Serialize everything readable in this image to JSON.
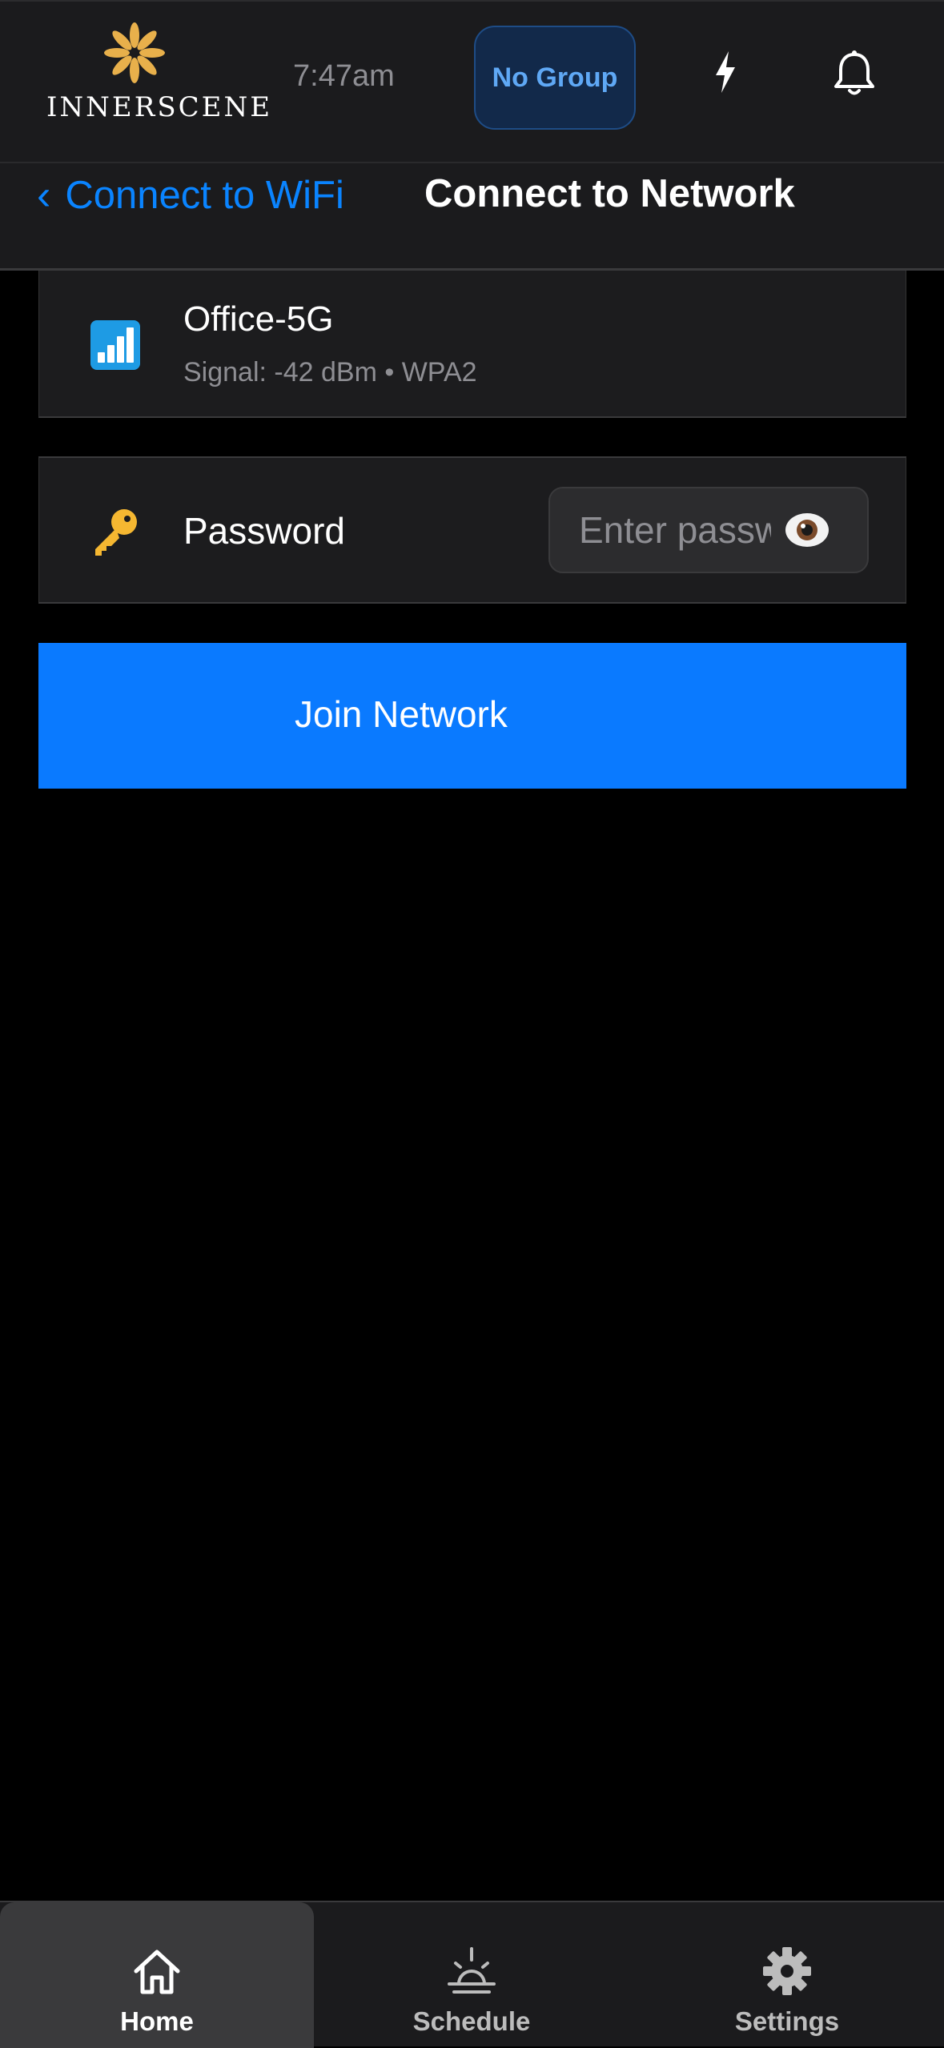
{
  "header": {
    "logo_text": "INNERSCENE",
    "time": "7:47am",
    "group_button": "No Group",
    "icons": [
      "lightning-icon",
      "bell-icon"
    ]
  },
  "nav": {
    "back_label": "Connect to WiFi",
    "back_chevron": "‹",
    "title": "Connect to Network"
  },
  "network": {
    "name": "Office-5G",
    "details": "Signal: -42 dBm • WPA2",
    "icon": "wifi-signal-icon"
  },
  "password": {
    "label": "Password",
    "placeholder": "Enter password",
    "value": "",
    "icon": "key-icon",
    "toggle_icon": "eye-icon"
  },
  "join_button": "Join Network",
  "tabs": [
    {
      "label": "Home",
      "icon": "home-icon",
      "active": true
    },
    {
      "label": "Schedule",
      "icon": "sunrise-icon",
      "active": false
    },
    {
      "label": "Settings",
      "icon": "gear-icon",
      "active": false
    }
  ],
  "colors": {
    "accent": "#0a84ff",
    "button": "#0a7aff",
    "logo_gold": "#e8b04b",
    "group_text": "#5fa8f5"
  }
}
